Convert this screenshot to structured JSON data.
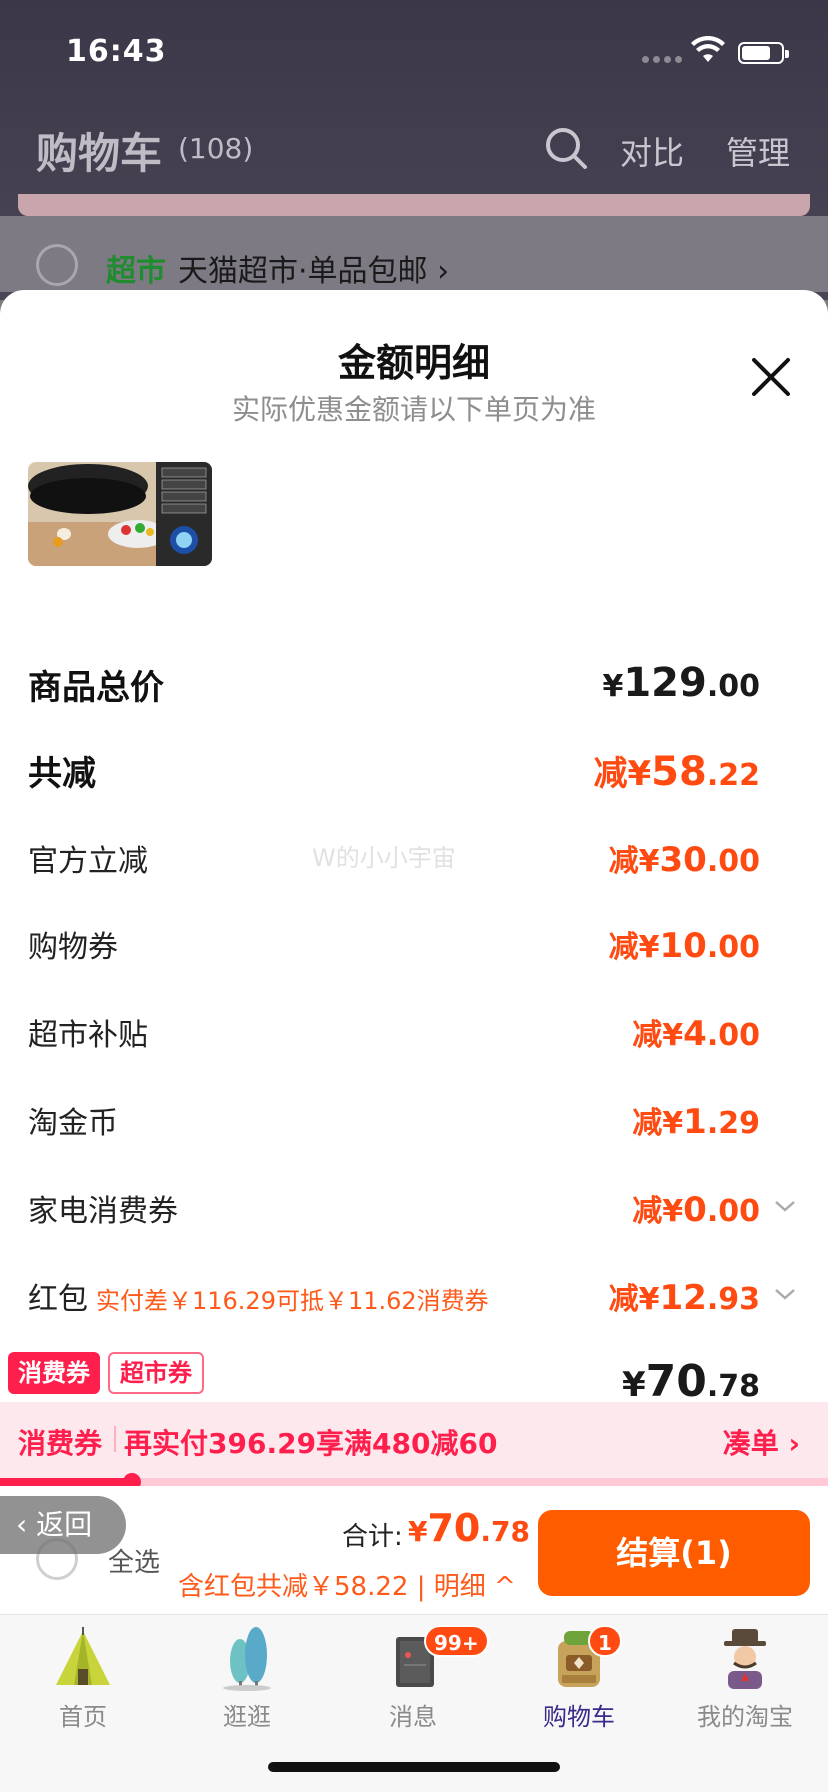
{
  "status_bar": {
    "time": "16:43"
  },
  "cart_header": {
    "title": "购物车",
    "count": "(108)",
    "compare": "对比",
    "manage": "管理"
  },
  "store": {
    "tag": "超市",
    "name": "天猫超市·单品包邮 ›"
  },
  "sheet": {
    "title": "金额明细",
    "subtitle": "实际优惠金额请以下单页为准",
    "watermark": "W的小小宇宙",
    "rows": [
      {
        "label": "商品总价",
        "prefix": "",
        "yen": "¥",
        "int": "129",
        "dec": ".00"
      },
      {
        "label": "共减",
        "prefix": "减",
        "yen": "¥",
        "int": "58",
        "dec": ".22"
      },
      {
        "label": "官方立减",
        "prefix": "减",
        "yen": "¥",
        "int": "30",
        "dec": ".00"
      },
      {
        "label": "购物券",
        "prefix": "减",
        "yen": "¥",
        "int": "10",
        "dec": ".00"
      },
      {
        "label": "超市补贴",
        "prefix": "减",
        "yen": "¥",
        "int": "4",
        "dec": ".00"
      },
      {
        "label": "淘金币",
        "prefix": "减",
        "yen": "¥",
        "int": "1",
        "dec": ".29"
      },
      {
        "label": "家电消费券",
        "prefix": "减",
        "yen": "¥",
        "int": "0",
        "dec": ".00"
      },
      {
        "label": "红包",
        "note": "实付差￥116.29可抵￥11.62消费券",
        "prefix": "减",
        "yen": "¥",
        "int": "12",
        "dec": ".93"
      },
      {
        "label": "",
        "prefix": "",
        "yen": "¥",
        "int": "70",
        "dec": ".78"
      }
    ]
  },
  "coupon_tags": [
    "消费券",
    "超市券"
  ],
  "coupon_bar": {
    "label": "消费券",
    "text": "再实付396.29享满480减60",
    "link": "凑单 ›",
    "progress": 0.16
  },
  "checkout": {
    "back": "‹ 返回",
    "select_all": "全选",
    "total_label": "合计:",
    "total_yen": "¥",
    "total_int": "70",
    "total_dec": ".78",
    "detail": "含红包共减￥58.22 | 明细 ^",
    "button": "结算(1)"
  },
  "tabs": [
    {
      "label": "首页",
      "icon": "home-tent-icon"
    },
    {
      "label": "逛逛",
      "icon": "trees-icon"
    },
    {
      "label": "消息",
      "icon": "message-book-icon",
      "badge": "99+"
    },
    {
      "label": "购物车",
      "icon": "cart-backpack-icon",
      "badge": "1",
      "active": true
    },
    {
      "label": "我的淘宝",
      "icon": "profile-man-icon"
    }
  ],
  "colors": {
    "accent": "#ff4a11",
    "coupon": "#ff1f4c",
    "checkout_button": "#ff5c00",
    "store_tag": "#1f8c2f"
  }
}
